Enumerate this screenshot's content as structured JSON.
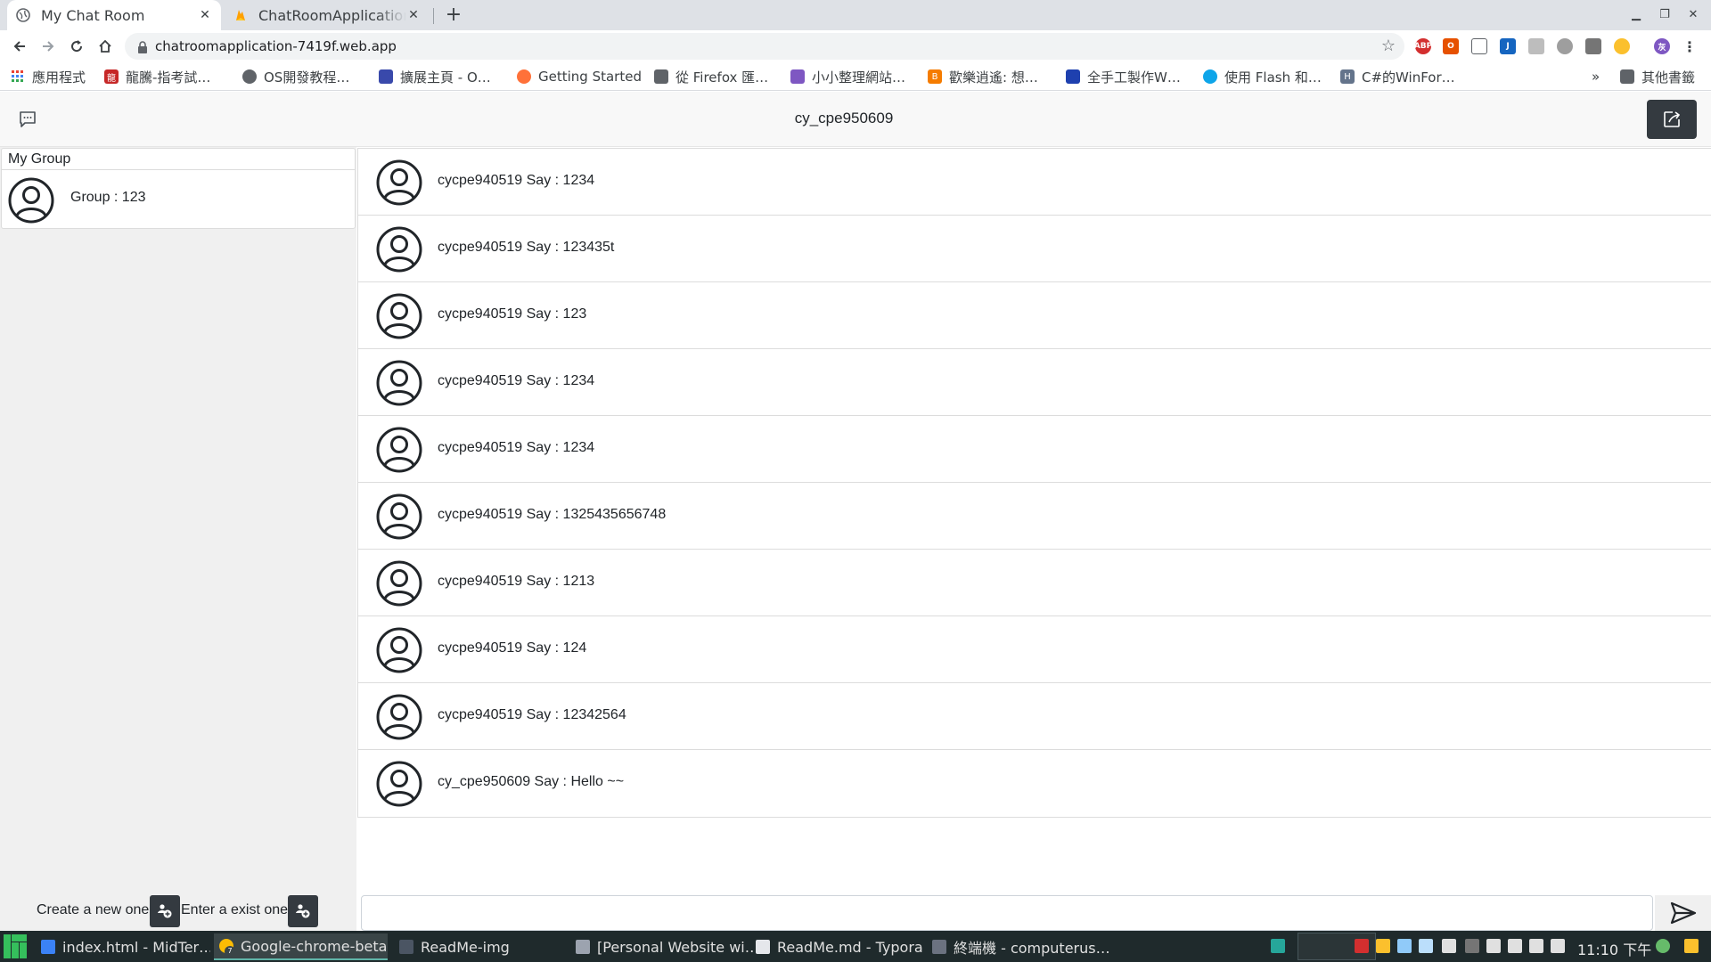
{
  "browser": {
    "tabs": [
      {
        "title": "My Chat Room",
        "active": true
      },
      {
        "title": "ChatRoomApplication",
        "active": false
      }
    ],
    "url": "chatroomapplication-7419f.web.app",
    "bookmarks": [
      {
        "label": "應用程式",
        "color": "#ea4335"
      },
      {
        "label": "龍騰-指考試…",
        "color": "#c62828"
      },
      {
        "label": "OS開發教程…",
        "color": "#5f6368"
      },
      {
        "label": "擴展主頁 - O…",
        "color": "#3949ab"
      },
      {
        "label": "Getting Started",
        "color": "#ff7139"
      },
      {
        "label": "從 Firefox 匯…",
        "color": "#5f6368"
      },
      {
        "label": "小小整理網站…",
        "color": "#7e57c2"
      },
      {
        "label": "歡樂逍遙: 想…",
        "color": "#f57c00"
      },
      {
        "label": "全手工製作W…",
        "color": "#1e40af"
      },
      {
        "label": "使用 Flash 和…",
        "color": "#0ea5e9"
      },
      {
        "label": "C#的WinFor…",
        "color": "#64748b"
      }
    ],
    "other_bookmarks": "其他書籤",
    "overflow": "»"
  },
  "app": {
    "current_user": "cy_cpe950609",
    "sidebar": {
      "heading": "My Group",
      "groups": [
        {
          "label": "Group : 123"
        }
      ],
      "create_label": "Create a new one",
      "enter_label": "Enter a exist one"
    },
    "messages": [
      {
        "text": "cycpe940519 Say : 1234"
      },
      {
        "text": "cycpe940519 Say : 123435t"
      },
      {
        "text": "cycpe940519 Say : 123"
      },
      {
        "text": "cycpe940519 Say : 1234"
      },
      {
        "text": "cycpe940519 Say : 1234"
      },
      {
        "text": "cycpe940519 Say : 1325435656748"
      },
      {
        "text": "cycpe940519 Say : 1213"
      },
      {
        "text": "cycpe940519 Say : 124"
      },
      {
        "text": "cycpe940519 Say : 12342564"
      },
      {
        "text": "cy_cpe950609 Say : Hello ~~"
      }
    ],
    "composer_value": ""
  },
  "taskbar": {
    "items": [
      {
        "label": "index.html - MidTer…",
        "color": "#3b82f6"
      },
      {
        "label": "Google-chrome-beta",
        "color": "#fbbc04",
        "active": true
      },
      {
        "label": "ReadMe-img",
        "color": "#4b5563"
      },
      {
        "label": "[Personal Website wi…",
        "color": "#9ca3af"
      },
      {
        "label": "ReadMe.md - Typora",
        "color": "#e5e7eb"
      },
      {
        "label": "終端機 - computerus…",
        "color": "#6b7280"
      }
    ],
    "clock": "11:10 下午",
    "chrome_badge": "7"
  },
  "colors": {
    "dark_button": "#343a40",
    "sidebar_bg": "#f0f0f0",
    "border": "#dcdcdc"
  }
}
